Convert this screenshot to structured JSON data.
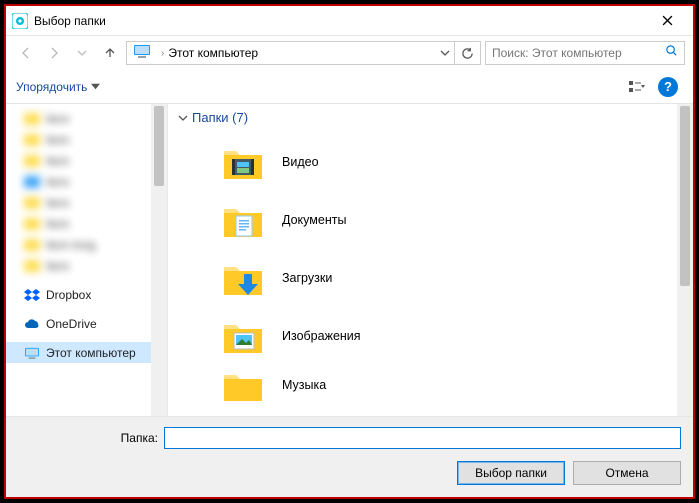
{
  "titlebar": {
    "title": "Выбор папки"
  },
  "address": {
    "crumb": "Этот компьютер"
  },
  "search": {
    "placeholder": "Поиск: Этот компьютер"
  },
  "toolbar": {
    "organize": "Упорядочить"
  },
  "group_header": "Папки (7)",
  "folders": [
    {
      "label": "Видео"
    },
    {
      "label": "Документы"
    },
    {
      "label": "Загрузки"
    },
    {
      "label": "Изображения"
    },
    {
      "label": "Музыка"
    }
  ],
  "sidebar": {
    "blurred": [
      "—",
      "—",
      "—",
      "—",
      "—",
      "—",
      "—",
      "—"
    ],
    "dropbox": "Dropbox",
    "onedrive": "OneDrive",
    "thispc": "Этот компьютер"
  },
  "bottom": {
    "folder_label": "Папка:",
    "select": "Выбор папки",
    "cancel": "Отмена",
    "value": ""
  }
}
